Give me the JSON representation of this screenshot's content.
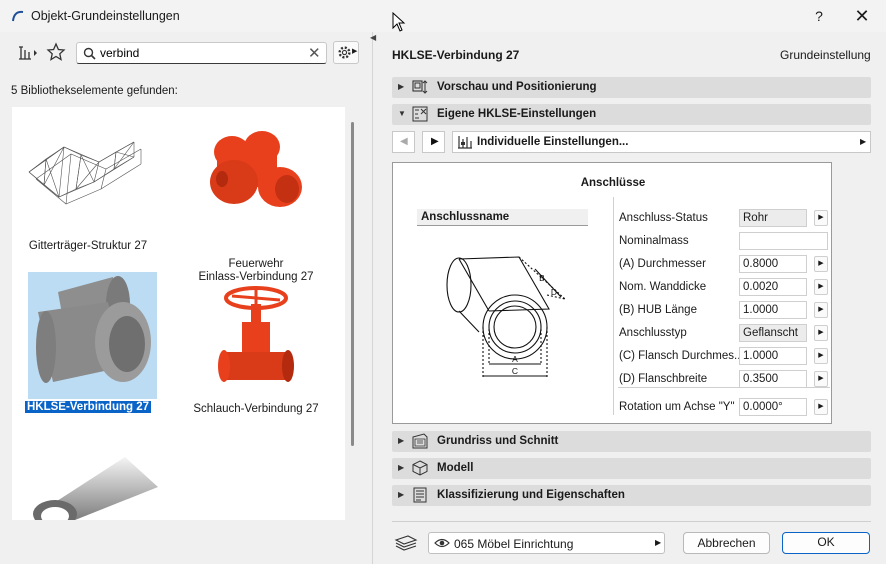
{
  "window": {
    "title": "Objekt-Grundeinstellungen",
    "help_label": "?",
    "close_label": "✕"
  },
  "library": {
    "search_value": "verbind",
    "found_label": "5 Bibliothekselemente gefunden:",
    "items": [
      {
        "label": "Gitterträger-Struktur 27",
        "selected": false
      },
      {
        "label": "Feuerwehr\nEinlass-Verbindung 27",
        "selected": false
      },
      {
        "label": "HKLSE-Verbindung 27",
        "selected": true
      },
      {
        "label": "Schlauch-Verbindung 27",
        "selected": false
      },
      {
        "label": "",
        "selected": false
      }
    ]
  },
  "header": {
    "object_name": "HKLSE-Verbindung 27",
    "mode_label": "Grundeinstellung"
  },
  "sections": {
    "preview": "Vorschau und Positionierung",
    "custom": "Eigene HKLSE-Einstellungen",
    "floorplan": "Grundriss und Schnitt",
    "model": "Modell",
    "classification": "Klassifizierung und Eigenschaften"
  },
  "preset": {
    "label": "Individuelle Einstellungen..."
  },
  "connections": {
    "title": "Anschlüsse",
    "name_label": "Anschlussname",
    "diagram_labels": {
      "a": "A",
      "b": "B",
      "c": "C",
      "d": "D"
    },
    "params": [
      {
        "label": "Anschluss-Status",
        "value": "Rohr"
      },
      {
        "label": "Nominalmass",
        "value": ""
      },
      {
        "label": "(A) Durchmesser",
        "value": "0.8000"
      },
      {
        "label": "Nom. Wanddicke",
        "value": "0.0020"
      },
      {
        "label": "(B) HUB Länge",
        "value": "1.0000"
      },
      {
        "label": "Anschlusstyp",
        "value": "Geflanscht"
      },
      {
        "label": "(C) Flansch Durchmes...",
        "value": "1.0000"
      },
      {
        "label": "(D) Flanschbreite",
        "value": "0.3500"
      },
      {
        "label": "Rotation um Achse \"Y\"",
        "value": "0.0000°"
      }
    ]
  },
  "footer": {
    "layer_label": "065 Möbel Einrichtung",
    "cancel_label": "Abbrechen",
    "ok_label": "OK"
  },
  "colors": {
    "accent": "#0a64c8",
    "selection_bg": "#bcdcf4",
    "fitting_red": "#e8401c"
  }
}
